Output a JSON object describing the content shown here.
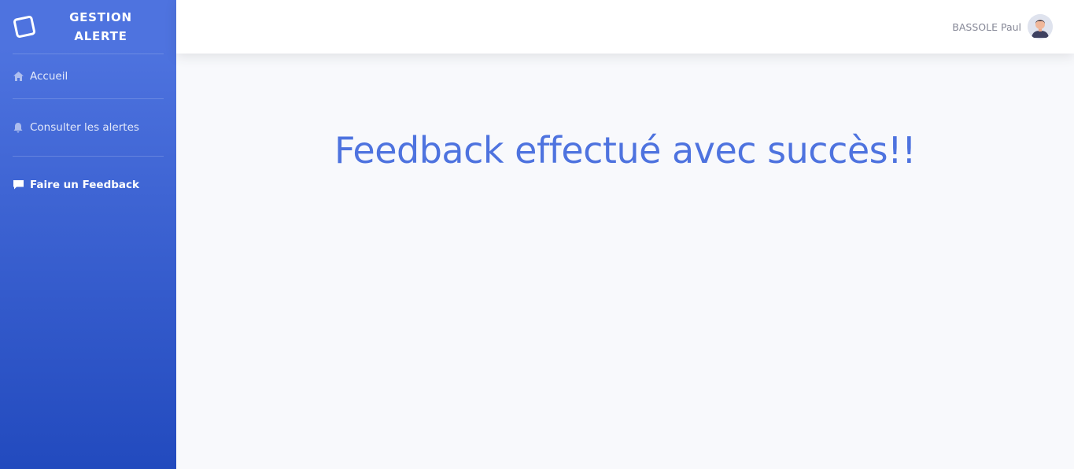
{
  "sidebar": {
    "brand_line1": "GESTION",
    "brand_line2": "ALERTE",
    "brand_icon": "notepad-icon",
    "items": [
      {
        "label": "Accueil",
        "icon": "home-icon"
      },
      {
        "label": "Consulter les alertes",
        "icon": "bell-icon"
      },
      {
        "label": "Faire un Feedback",
        "icon": "comment-icon",
        "active": true
      }
    ]
  },
  "topbar": {
    "user_name": "BASSOLE Paul",
    "avatar_icon": "user-avatar"
  },
  "main": {
    "message": "Feedback effectué avec succès!!"
  },
  "colors": {
    "primary": "#4e73df",
    "sidebar_end": "#224abe",
    "page_bg": "#f8f9fc",
    "muted_text": "#858796"
  }
}
